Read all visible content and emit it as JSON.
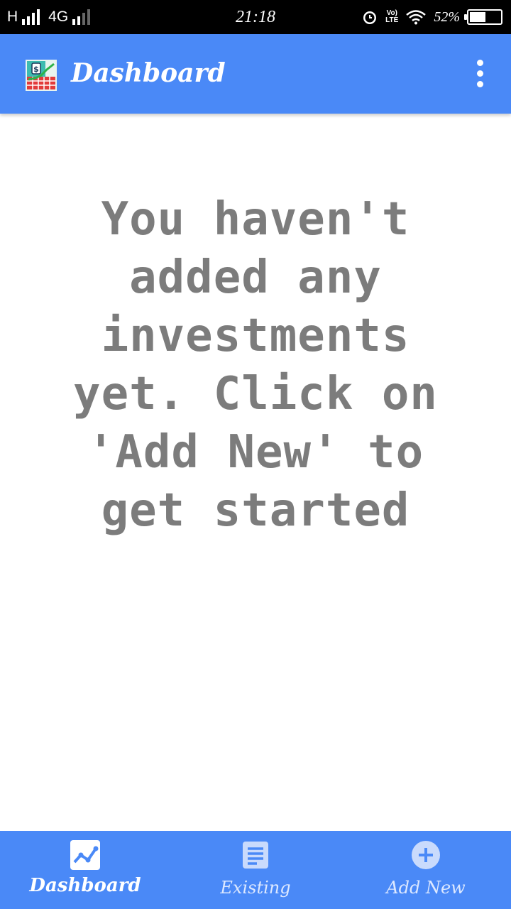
{
  "status_bar": {
    "network_h": "H",
    "network_4g": "4G",
    "time": "21:18",
    "volte": "Vo) LTE",
    "battery_pct": "52%",
    "battery_level": 0.52
  },
  "app_bar": {
    "title": "Dashboard",
    "logo_icon": "investment-chart-icon",
    "menu_icon": "more-vert-icon"
  },
  "empty_state": {
    "message": "You haven't added any investments yet. Click on 'Add New' to get started"
  },
  "bottom_nav": {
    "items": [
      {
        "label": "Dashboard",
        "icon": "trending-chart-icon",
        "active": true
      },
      {
        "label": "Existing",
        "icon": "document-list-icon",
        "active": false
      },
      {
        "label": "Add New",
        "icon": "add-circle-icon",
        "active": false
      }
    ]
  },
  "colors": {
    "primary": "#4a89f7",
    "message_text": "#7c7c7c",
    "status_bar": "#000000"
  }
}
